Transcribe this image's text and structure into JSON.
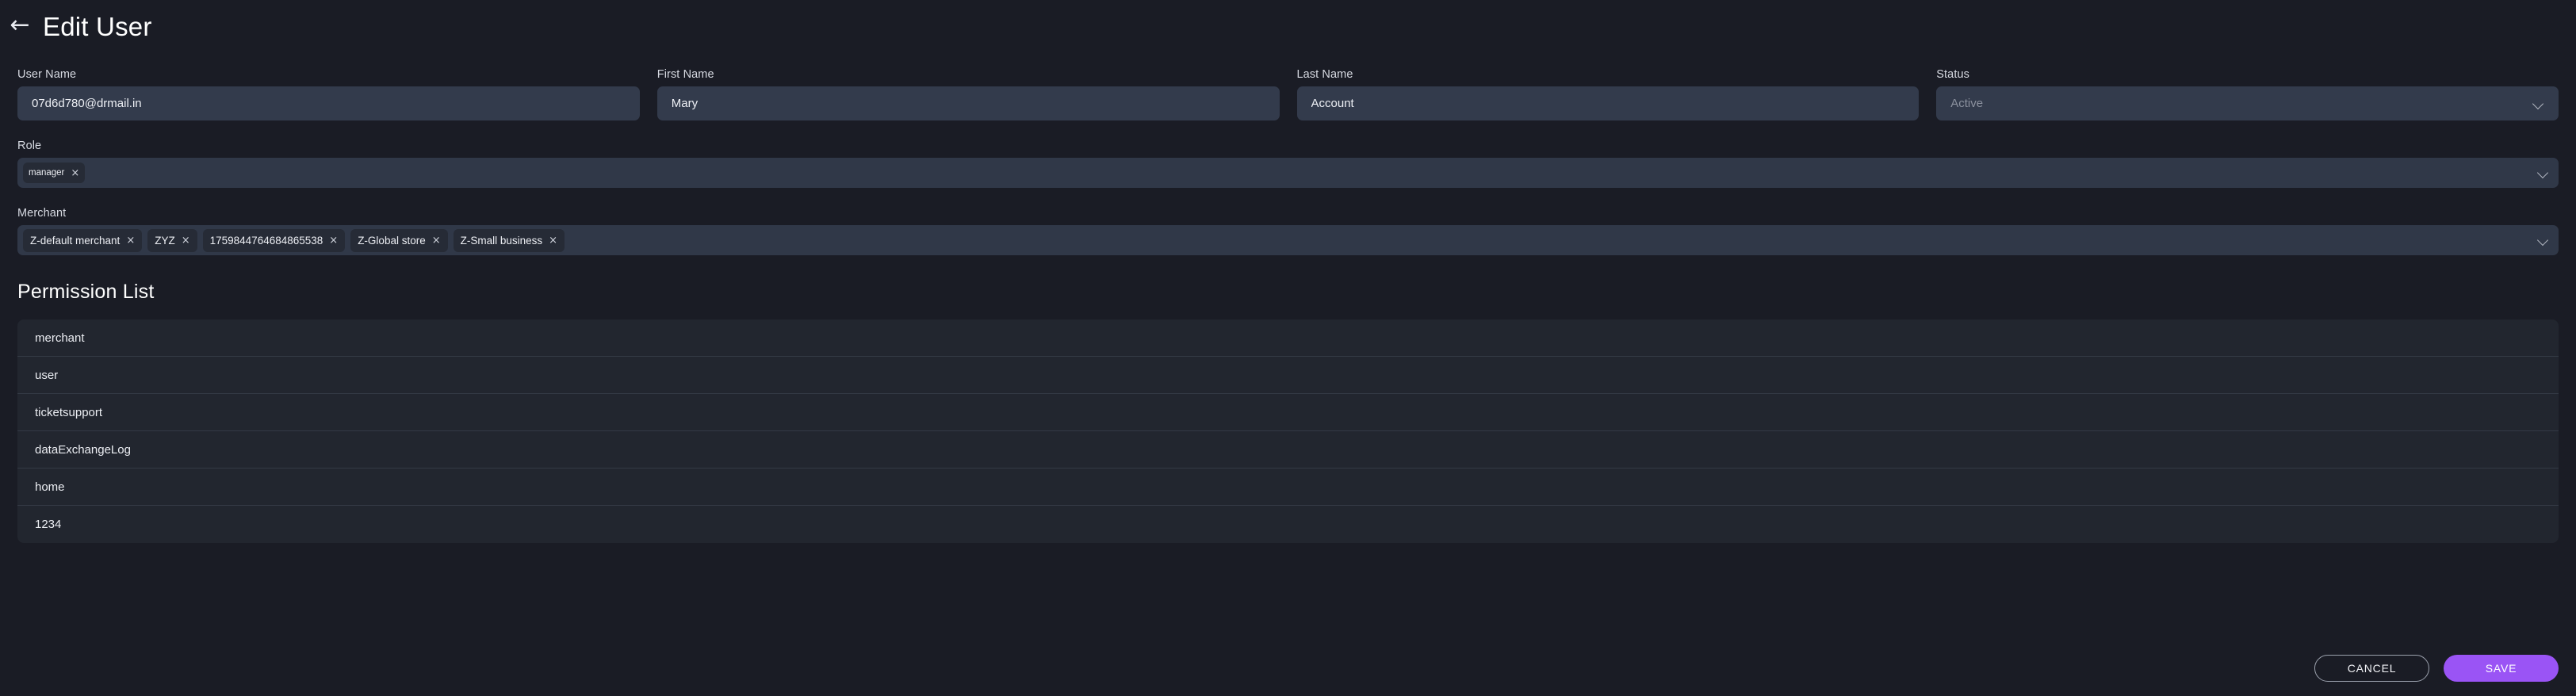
{
  "header": {
    "back_icon": "arrow-left-icon",
    "back_glyph": "←",
    "title": "Edit User"
  },
  "form": {
    "fields": [
      {
        "label": "User Name",
        "value": "07d6d780@drmail.in",
        "type": "text"
      },
      {
        "label": "First Name",
        "value": "Mary",
        "type": "text"
      },
      {
        "label": "Last Name",
        "value": "Account",
        "type": "text"
      }
    ],
    "status": {
      "label": "Status",
      "placeholder": "Active",
      "value": "",
      "icon": "chevron-down-icon"
    },
    "role": {
      "label": "Role",
      "icon": "chevron-down-icon",
      "chips": [
        {
          "label": "manager",
          "remove": "×"
        }
      ]
    },
    "merchant": {
      "label": "Merchant",
      "icon": "chevron-down-icon",
      "chips": [
        {
          "label": "Z-default merchant",
          "remove": "×"
        },
        {
          "label": "ZYZ",
          "remove": "×"
        },
        {
          "label": "1759844764684865538",
          "remove": "×"
        },
        {
          "label": "Z-Global store",
          "remove": "×"
        },
        {
          "label": "Z-Small business",
          "remove": "×"
        }
      ]
    }
  },
  "permissions": {
    "title": "Permission List",
    "items": [
      {
        "label": "merchant"
      },
      {
        "label": "user"
      },
      {
        "label": "ticketsupport"
      },
      {
        "label": "dataExchangeLog"
      },
      {
        "label": "home"
      },
      {
        "label": "1234"
      }
    ]
  },
  "footer": {
    "cancel_label": "CANCEL",
    "save_label": "SAVE"
  },
  "colors": {
    "page_background": "#1a1c25",
    "input_background": "#333b4c",
    "select_background": "#303848",
    "chip_background": "#262b36",
    "list_background": "#22262f",
    "accent": "#9a54f5",
    "text": "#eceef3",
    "placeholder": "#8b919e"
  }
}
